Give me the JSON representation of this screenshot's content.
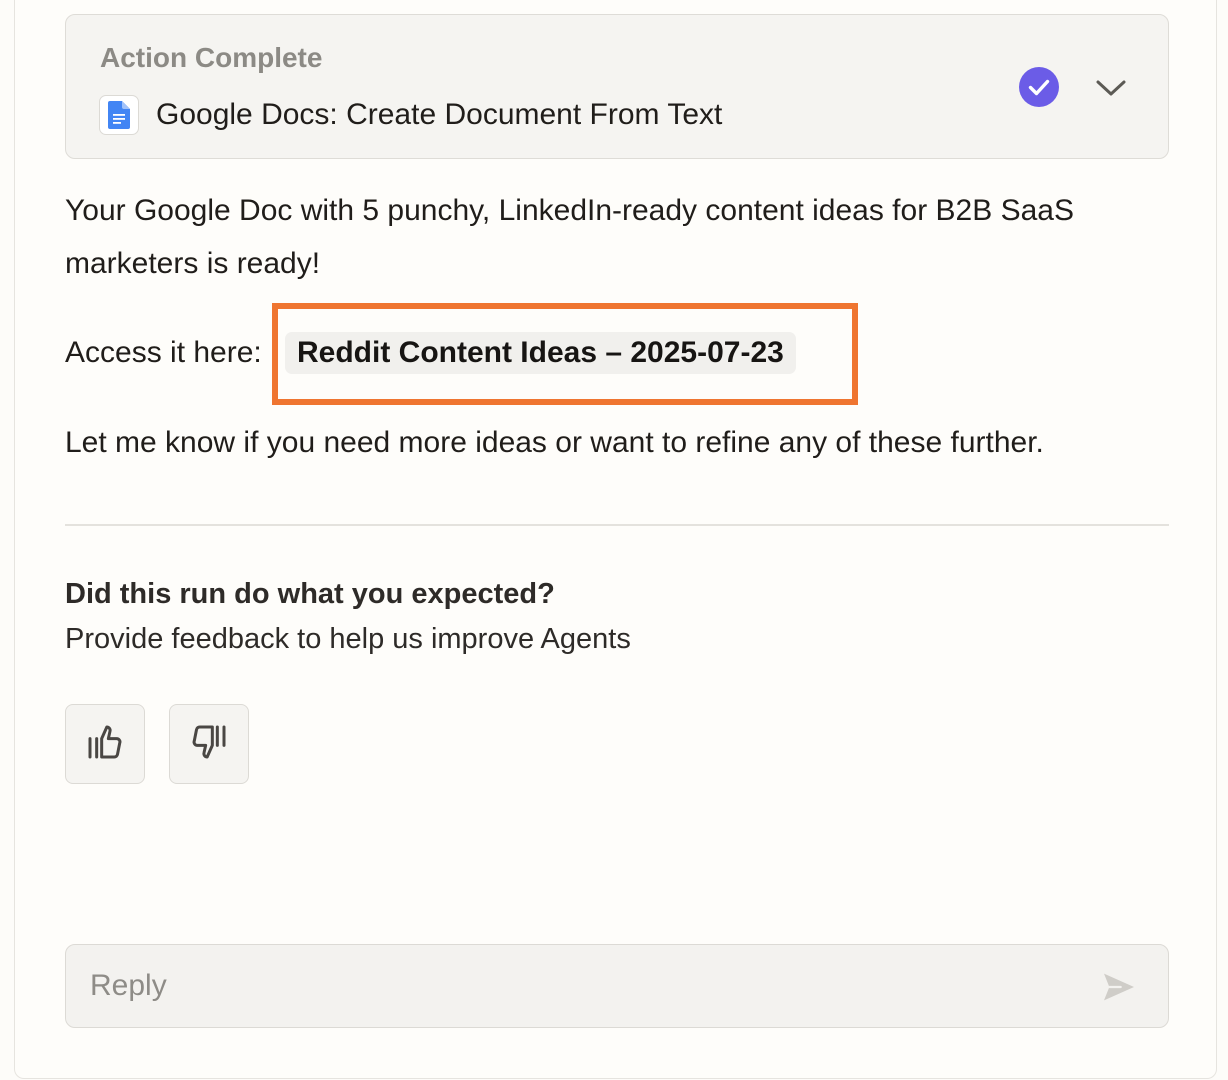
{
  "action_card": {
    "status": "Action Complete",
    "title": "Google Docs: Create Document From Text",
    "app_icon": "google-docs-icon",
    "status_icon": "check-circle-icon",
    "expand_icon": "chevron-down-icon",
    "accent_color": "#6b5ce7"
  },
  "message": {
    "line1": "Your Google Doc with 5 punchy, LinkedIn-ready content ideas for B2B SaaS marketers is ready!",
    "access_label": "Access it here:",
    "doc_link": "Reddit Content Ideas – 2025-07-23",
    "line3": "Let me know if you need more ideas or want to refine any of these further."
  },
  "feedback": {
    "question": "Did this run do what you expected?",
    "subtext": "Provide feedback to help us improve Agents",
    "thumbs_up_icon": "thumbs-up-icon",
    "thumbs_down_icon": "thumbs-down-icon"
  },
  "reply": {
    "placeholder": "Reply",
    "value": "",
    "send_icon": "send-icon"
  },
  "colors": {
    "highlight": "#ef7530"
  }
}
